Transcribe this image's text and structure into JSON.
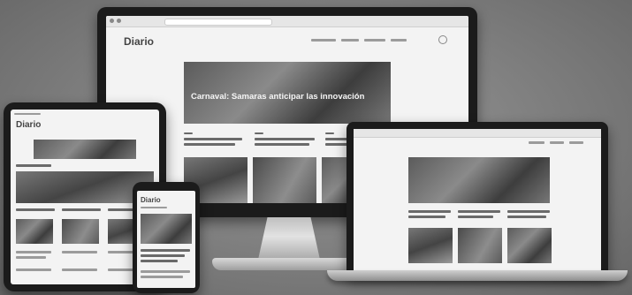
{
  "scene": {
    "description_visible_text": false
  },
  "monitor": {
    "logo": "Diario",
    "hero_headline": "Carnaval: Samaras anticipar las innovación"
  },
  "tablet": {
    "logo": "Diario"
  },
  "laptop": {},
  "phone": {
    "logo": "Diario"
  }
}
